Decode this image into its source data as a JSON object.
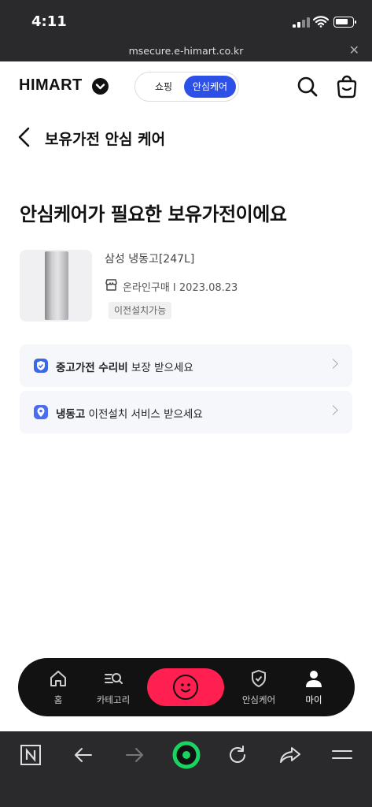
{
  "status_bar": {
    "time": "4:11"
  },
  "browser": {
    "url": "msecure.e-himart.co.kr"
  },
  "header": {
    "logo": "HIMART",
    "tabs": [
      "쇼핑",
      "안심케어"
    ],
    "active_tab": "안심케어"
  },
  "page": {
    "title": "보유가전 안심 케어",
    "headline": "안심케어가 필요한 보유가전이에요"
  },
  "product": {
    "name": "삼성 냉동고[247L]",
    "meta": "온라인구매 I 2023.08.23",
    "tag": "이전설치가능"
  },
  "cards": [
    {
      "bold": "중고가전 수리비",
      "rest": " 보장 받으세요",
      "icon": "shield-check-icon"
    },
    {
      "bold": "냉동고",
      "rest": " 이전설치 서비스 받으세요",
      "icon": "location-pin-icon"
    }
  ],
  "bottom_nav": [
    {
      "label": "홈",
      "icon": "home-icon"
    },
    {
      "label": "카테고리",
      "icon": "category-search-icon"
    },
    {
      "label": "",
      "icon": "smile-face-icon"
    },
    {
      "label": "안심케어",
      "icon": "shield-icon"
    },
    {
      "label": "마이",
      "icon": "person-icon"
    }
  ],
  "colors": {
    "accent": "#2d51e6",
    "center_button": "#ff1f50"
  }
}
